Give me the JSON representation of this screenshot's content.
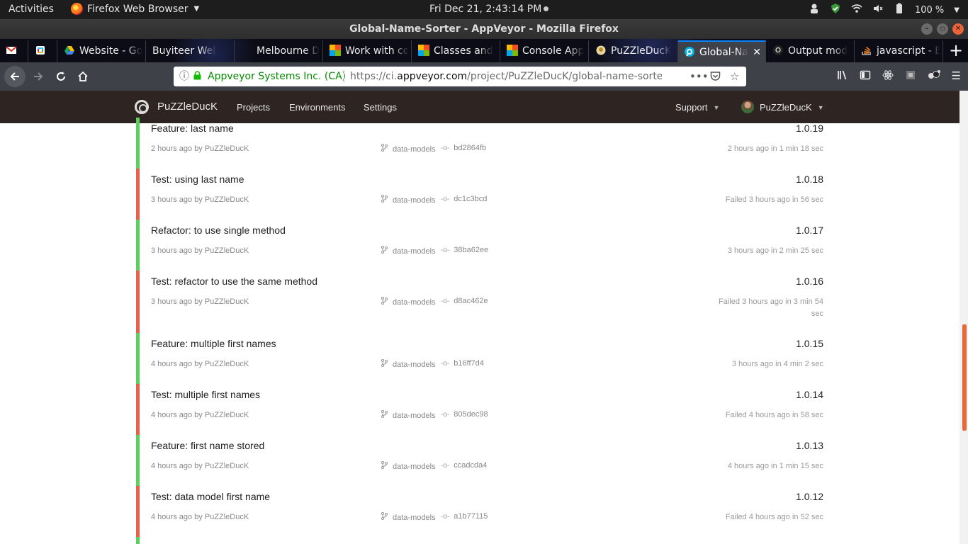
{
  "topbar": {
    "activities": "Activities",
    "app_name": "Firefox Web Browser",
    "clock": "Fri Dec 21,  2:43:14 PM",
    "battery": "100 %"
  },
  "window": {
    "title": "Global-Name-Sorter - AppVeyor - Mozilla Firefox"
  },
  "tabs": [
    {
      "label": "",
      "icon": "gmail-icon"
    },
    {
      "label": "",
      "icon": "slack-icon"
    },
    {
      "label": "Website - Go",
      "icon": "google-drive-icon"
    },
    {
      "label": "Buyiteer Web A",
      "icon": ""
    },
    {
      "label": "Melbourne D",
      "icon": ""
    },
    {
      "label": "Work with co",
      "icon": "microsoft-icon"
    },
    {
      "label": "Classes and",
      "icon": "microsoft-icon"
    },
    {
      "label": "Console App",
      "icon": "microsoft-icon"
    },
    {
      "label": "PuZZleDucK",
      "icon": "duck-icon"
    },
    {
      "label": "Global-Na",
      "icon": "appveyor-icon"
    },
    {
      "label": "Output mod",
      "icon": "github-icon"
    },
    {
      "label": "javascript - E",
      "icon": "stackoverflow-icon"
    }
  ],
  "urlbar": {
    "org": "Appveyor Systems Inc. (CA)",
    "url_prefix": "https://ci.",
    "url_domain": "appveyor.com",
    "url_path": "/project/PuZZleDucK/global-name-sorter/"
  },
  "appveyor": {
    "account": "PuZZleDucK",
    "nav": [
      "Projects",
      "Environments",
      "Settings"
    ],
    "support": "Support",
    "user": "PuZZleDucK"
  },
  "builds": [
    {
      "message": "Feature: last name",
      "version": "1.0.19",
      "author": "2 hours ago by PuZZleDucK",
      "branch": "data-models",
      "commit": "bd2864fb",
      "duration": "2 hours ago in 1 min 18 sec",
      "status": "success"
    },
    {
      "message": "Test: using last name",
      "version": "1.0.18",
      "author": "3 hours ago by PuZZleDucK",
      "branch": "data-models",
      "commit": "dc1c3bcd",
      "duration": "Failed 3 hours ago in 56 sec",
      "status": "failed"
    },
    {
      "message": "Refactor: to use single method",
      "version": "1.0.17",
      "author": "3 hours ago by PuZZleDucK",
      "branch": "data-models",
      "commit": "38ba62ee",
      "duration": "3 hours ago in 2 min 25 sec",
      "status": "success"
    },
    {
      "message": "Test: refactor to use the same method",
      "version": "1.0.16",
      "author": "3 hours ago by PuZZleDucK",
      "branch": "data-models",
      "commit": "d8ac462e",
      "duration": "Failed 3 hours ago in 3 min 54 sec",
      "status": "failed"
    },
    {
      "message": "Feature: multiple first names",
      "version": "1.0.15",
      "author": "4 hours ago by PuZZleDucK",
      "branch": "data-models",
      "commit": "b16ff7d4",
      "duration": "3 hours ago in 4 min 2 sec",
      "status": "success"
    },
    {
      "message": "Test: multiple first names",
      "version": "1.0.14",
      "author": "4 hours ago by PuZZleDucK",
      "branch": "data-models",
      "commit": "805dec98",
      "duration": "Failed 4 hours ago in 58 sec",
      "status": "failed"
    },
    {
      "message": "Feature: first name stored",
      "version": "1.0.13",
      "author": "4 hours ago by PuZZleDucK",
      "branch": "data-models",
      "commit": "ccadcda4",
      "duration": "4 hours ago in 1 min 15 sec",
      "status": "success"
    },
    {
      "message": "Test: data model first name",
      "version": "1.0.12",
      "author": "4 hours ago by PuZZleDucK",
      "branch": "data-models",
      "commit": "a1b77115",
      "duration": "Failed 4 hours ago in 52 sec",
      "status": "failed"
    }
  ],
  "colors": {
    "success": "#5cd05c",
    "failed": "#e8604c",
    "header_bg": "#2e2422",
    "accent": "#0a84ff"
  }
}
